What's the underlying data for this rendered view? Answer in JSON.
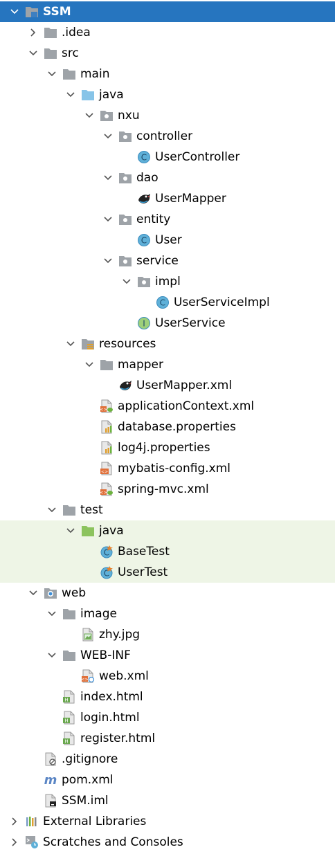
{
  "project_tree": {
    "items": [
      {
        "label": "SSM",
        "icon": "module-folder-icon",
        "depth": 0,
        "expanded": true,
        "selected": true
      },
      {
        "label": ".idea",
        "icon": "folder-icon",
        "depth": 1,
        "expanded": false
      },
      {
        "label": "src",
        "icon": "folder-icon",
        "depth": 1,
        "expanded": true
      },
      {
        "label": "main",
        "icon": "folder-icon",
        "depth": 2,
        "expanded": true
      },
      {
        "label": "java",
        "icon": "source-root-folder-icon",
        "depth": 3,
        "expanded": true
      },
      {
        "label": "nxu",
        "icon": "package-icon",
        "depth": 4,
        "expanded": true
      },
      {
        "label": "controller",
        "icon": "package-icon",
        "depth": 5,
        "expanded": true
      },
      {
        "label": "UserController",
        "icon": "class-icon",
        "depth": 6
      },
      {
        "label": "dao",
        "icon": "package-icon",
        "depth": 5,
        "expanded": true
      },
      {
        "label": "UserMapper",
        "icon": "mybatis-bird-icon",
        "depth": 6
      },
      {
        "label": "entity",
        "icon": "package-icon",
        "depth": 5,
        "expanded": true
      },
      {
        "label": "User",
        "icon": "class-icon",
        "depth": 6
      },
      {
        "label": "service",
        "icon": "package-icon",
        "depth": 5,
        "expanded": true
      },
      {
        "label": "impl",
        "icon": "package-icon",
        "depth": 6,
        "expanded": true
      },
      {
        "label": "UserServiceImpl",
        "icon": "class-icon",
        "depth": 7
      },
      {
        "label": "UserService",
        "icon": "interface-icon",
        "depth": 6
      },
      {
        "label": "resources",
        "icon": "resources-folder-icon",
        "depth": 3,
        "expanded": true
      },
      {
        "label": "mapper",
        "icon": "folder-icon",
        "depth": 4,
        "expanded": true
      },
      {
        "label": "UserMapper.xml",
        "icon": "mybatis-bird-icon",
        "depth": 5
      },
      {
        "label": "applicationContext.xml",
        "icon": "spring-xml-icon",
        "depth": 4
      },
      {
        "label": "database.properties",
        "icon": "properties-icon",
        "depth": 4
      },
      {
        "label": "log4j.properties",
        "icon": "properties-icon",
        "depth": 4
      },
      {
        "label": "mybatis-config.xml",
        "icon": "xml-file-icon",
        "depth": 4
      },
      {
        "label": "spring-mvc.xml",
        "icon": "spring-xml-icon",
        "depth": 4
      },
      {
        "label": "test",
        "icon": "folder-icon",
        "depth": 2,
        "expanded": true
      },
      {
        "label": "java",
        "icon": "test-root-folder-icon",
        "depth": 3,
        "expanded": true,
        "test": true
      },
      {
        "label": "BaseTest",
        "icon": "test-class-icon",
        "depth": 4,
        "test": true
      },
      {
        "label": "UserTest",
        "icon": "test-class-icon",
        "depth": 4,
        "test": true
      },
      {
        "label": "web",
        "icon": "web-folder-icon",
        "depth": 1,
        "expanded": true
      },
      {
        "label": "image",
        "icon": "folder-icon",
        "depth": 2,
        "expanded": true
      },
      {
        "label": "zhy.jpg",
        "icon": "image-file-icon",
        "depth": 3
      },
      {
        "label": "WEB-INF",
        "icon": "folder-icon",
        "depth": 2,
        "expanded": true
      },
      {
        "label": "web.xml",
        "icon": "web-xml-icon",
        "depth": 3
      },
      {
        "label": "index.html",
        "icon": "html-file-icon",
        "depth": 2
      },
      {
        "label": "login.html",
        "icon": "html-file-icon",
        "depth": 2
      },
      {
        "label": "register.html",
        "icon": "html-file-icon",
        "depth": 2
      },
      {
        "label": ".gitignore",
        "icon": "ignore-file-icon",
        "depth": 1
      },
      {
        "label": "pom.xml",
        "icon": "maven-icon",
        "depth": 1
      },
      {
        "label": "SSM.iml",
        "icon": "iml-file-icon",
        "depth": 1
      },
      {
        "label": "External Libraries",
        "icon": "libraries-icon",
        "depth": 0,
        "expanded": false
      },
      {
        "label": "Scratches and Consoles",
        "icon": "scratches-icon",
        "depth": 0,
        "expanded": false
      }
    ]
  },
  "colors": {
    "selection": "#2675bf",
    "test_highlight": "#eef5e6",
    "folder": "#9ea3a8",
    "source_root": "#87c4e8",
    "test_root": "#8cc35e",
    "class_badge": "#5fb0d8"
  }
}
